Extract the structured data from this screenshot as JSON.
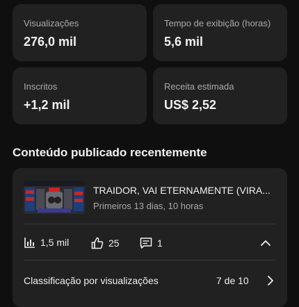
{
  "stats": [
    {
      "label": "Visualizações",
      "value": "276,0 mil"
    },
    {
      "label": "Tempo de exibição (horas)",
      "value": "5,6 mil"
    },
    {
      "label": "Inscritos",
      "value": "+1,2 mil"
    },
    {
      "label": "Receita estimada",
      "value": "US$ 2,52"
    }
  ],
  "recent_content": {
    "section_title": "Conteúdo publicado recentemente",
    "video": {
      "title": "TRAIDOR, VAI ETERNAMENTE (VIRA...",
      "subtitle": "Primeiros 13 dias, 10 horas"
    },
    "metrics": {
      "views": "1,5 mil",
      "likes": "25",
      "comments": "1"
    },
    "ranking": {
      "label": "Classificação por visualizações",
      "value": "7 de 10"
    }
  },
  "icons": {
    "views": "bar-chart-icon",
    "likes": "thumbs-up-icon",
    "comments": "comment-icon",
    "collapse": "chevron-up-icon",
    "next": "chevron-right-icon"
  }
}
